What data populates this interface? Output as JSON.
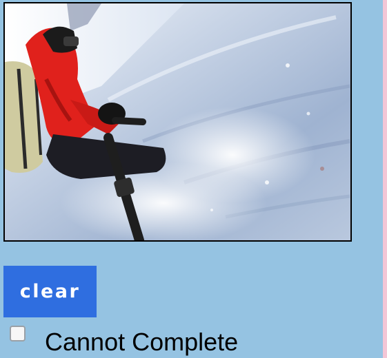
{
  "image": {
    "alt": "",
    "colors": {
      "snow": "#dfe8f4",
      "snow_shadow": "#8da4c3",
      "jacket": "#e0211c",
      "backpack": "#cfcba0",
      "pole": "#1e1e1e",
      "frame": "#000000"
    }
  },
  "clear_button": {
    "label": "clear",
    "color": "#2f6ee0"
  },
  "cannot_complete": {
    "label": "Cannot Complete",
    "checked": false
  },
  "colors": {
    "panel_background": "#95c3e2",
    "page_background": "#f3c6d6"
  }
}
